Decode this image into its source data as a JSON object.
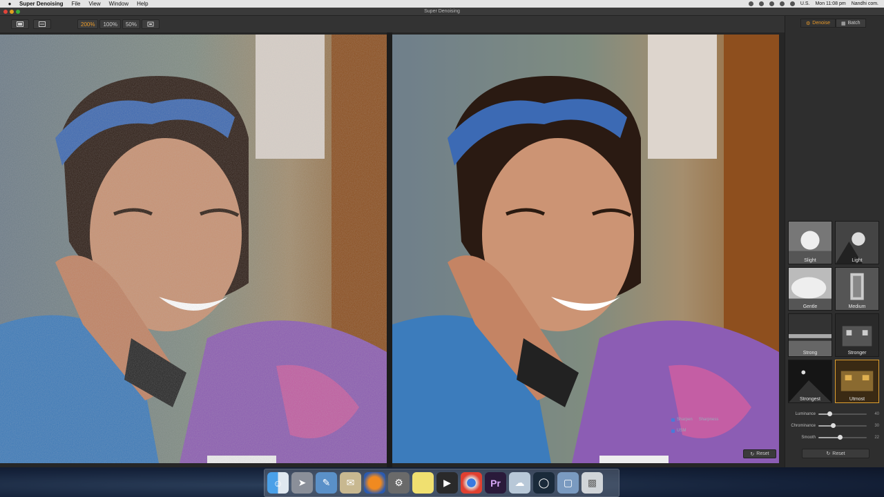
{
  "menubar": {
    "apple": "",
    "app_name": "Super Denoising",
    "items": [
      "File",
      "View",
      "Window",
      "Help"
    ],
    "input_source": "U.S.",
    "clock": "Mon 11:08 pm",
    "user": "Nandhi com."
  },
  "window": {
    "title": "Super Denoising"
  },
  "toolbar": {
    "zoom_options": [
      "200%",
      "100%",
      "50%"
    ],
    "active_zoom": "200%"
  },
  "sidebar": {
    "tabs": [
      {
        "label": "Denoise",
        "active": true
      },
      {
        "label": "Batch",
        "active": false
      }
    ],
    "presets": [
      {
        "label": "Slight"
      },
      {
        "label": "Light"
      },
      {
        "label": "Gentle"
      },
      {
        "label": "Medium"
      },
      {
        "label": "Strong"
      },
      {
        "label": "Stronger"
      },
      {
        "label": "Strongest"
      },
      {
        "label": "Utmost",
        "active": true
      }
    ],
    "sliders": [
      {
        "label": "Luminance",
        "value": "40",
        "fraction": 0.23
      },
      {
        "label": "Chrominance",
        "value": "30",
        "fraction": 0.3
      },
      {
        "label": "Smooth",
        "value": "22",
        "fraction": 0.44
      }
    ],
    "reset_label": "Reset"
  },
  "viewer": {
    "overlay": {
      "sharpen_label": "Sharpen",
      "sharpness_label": "Sharpness",
      "usm_label": "USM"
    },
    "reset_label": "Reset"
  },
  "colors": {
    "accent": "#e99a2a",
    "menubar": "#e4e4e4",
    "toolbar": "#333333",
    "sidebar": "#2e2e2e"
  },
  "dock": {
    "icons": [
      "finder-icon",
      "launchpad-icon",
      "preview-icon",
      "contacts-icon",
      "firefox-icon",
      "system-preferences-icon",
      "notes-icon",
      "final-cut-icon",
      "chrome-icon",
      "premiere-icon",
      "photos-icon",
      "quicktime-icon",
      "folder-icon",
      "trash-icon"
    ],
    "premiere_label": "Pr"
  }
}
